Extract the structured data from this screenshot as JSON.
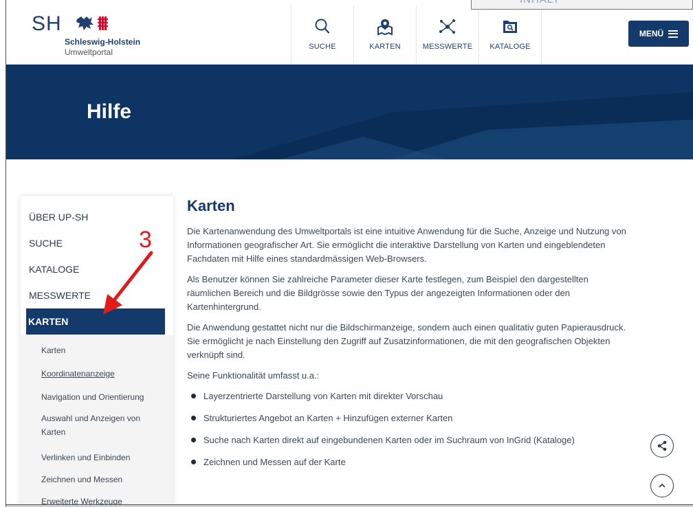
{
  "inhalt_tab": "INHALT",
  "header": {
    "logo_mark": "SH",
    "logo_name": "Schleswig-Holstein",
    "logo_sub": "Umweltportal",
    "nav": [
      {
        "label": "SUCHE",
        "icon": "search-icon"
      },
      {
        "label": "KARTEN",
        "icon": "map-pin-icon"
      },
      {
        "label": "MESSWERTE",
        "icon": "network-icon"
      },
      {
        "label": "KATALOGE",
        "icon": "catalog-icon"
      }
    ],
    "menu_label": "MENÜ"
  },
  "hero": {
    "title": "Hilfe"
  },
  "sidebar": {
    "items": [
      "ÜBER UP-SH",
      "SUCHE",
      "KATALOGE",
      "MESSWERTE",
      "KARTEN"
    ],
    "active": "KARTEN",
    "subitems": [
      "Karten",
      "Koordinatenanzeige",
      "Navigation und Orientierung",
      "Auswahl und Anzeigen von Karten",
      "Verlinken und Einbinden",
      "Zeichnen und Messen",
      "Erweiterte Werkzeuge"
    ]
  },
  "main": {
    "title": "Karten",
    "paragraphs": [
      "Die Kartenanwendung des Umweltportals ist eine intuitive Anwendung für die Suche, Anzeige und Nutzung von Informationen geografischer Art. Sie ermöglicht die interaktive Darstellung von Karten und eingeblendeten Fachdaten mit Hilfe eines standardmässigen Web-Browsers.",
      "Als Benutzer können Sie zahlreiche Parameter dieser Karte festlegen, zum Beispiel den dargestellten räumlichen Bereich und die Bildgrösse sowie den Typus der angezeigten Informationen oder den Kartenhintergrund.",
      "Die Anwendung gestattet nicht nur die Bildschirmanzeige, sondern auch einen qualitativ guten Papierausdruck. Sie ermöglicht je nach Einstellung den Zugriff auf Zusatzinformationen, die mit den geografischen Objekten verknüpft sind.",
      "Seine Funktionalität umfasst u.a.:"
    ],
    "bullets": [
      "Layerzentrierte Darstellung von Karten mit direkter Vorschau",
      "Strukturiertes Angebot an Karten + Hinzufügen externer Karten",
      "Suche nach Karten direkt auf eingebundenen Karten oder im Suchraum von InGrid (Kataloge)",
      "Zeichnen und Messen auf der Karte"
    ]
  },
  "annotation": {
    "number": "3",
    "color": "#e01b1b"
  },
  "colors": {
    "brand": "#133a6a",
    "hero": "#0d3463"
  }
}
